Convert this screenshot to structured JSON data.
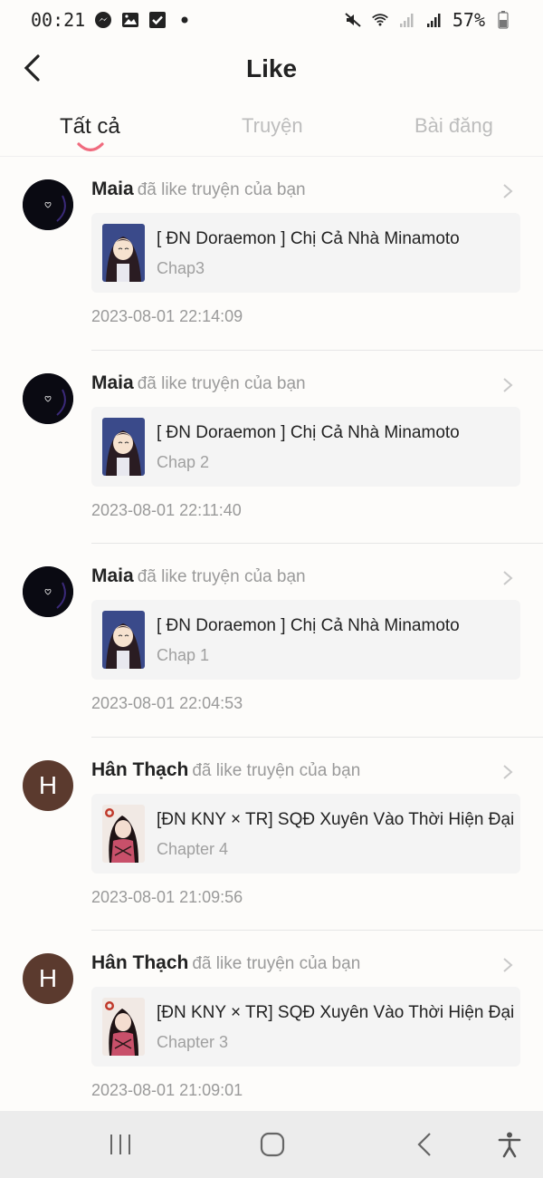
{
  "status_bar": {
    "time": "00:21",
    "battery": "57%",
    "left_icons": [
      "messenger-icon",
      "gallery-icon",
      "check-icon",
      "dot-icon"
    ],
    "right_icons": [
      "mute-icon",
      "wifi-icon",
      "signal-icon",
      "signal-icon",
      "battery-icon"
    ]
  },
  "header": {
    "title": "Like",
    "back_icon": "chevron-left-icon"
  },
  "tabs": [
    {
      "label": "Tất cả",
      "active": true
    },
    {
      "label": "Truyện",
      "active": false
    },
    {
      "label": "Bài đăng",
      "active": false
    }
  ],
  "notifications": [
    {
      "user": "Maia",
      "action": "đã like truyện của bạn",
      "story": "[ ĐN Doraemon ] Chị Cả Nhà Minamoto",
      "chapter": "Chap3",
      "time": "2023-08-01 22:14:09",
      "avatar_type": "dark"
    },
    {
      "user": "Maia",
      "action": "đã like truyện của bạn",
      "story": "[ ĐN Doraemon ] Chị Cả Nhà Minamoto",
      "chapter": "Chap 2",
      "time": "2023-08-01 22:11:40",
      "avatar_type": "dark"
    },
    {
      "user": "Maia",
      "action": "đã like truyện của bạn",
      "story": "[ ĐN Doraemon ] Chị Cả Nhà Minamoto",
      "chapter": "Chap 1",
      "time": "2023-08-01 22:04:53",
      "avatar_type": "dark"
    },
    {
      "user": "Hân Thạch",
      "action": "đã like truyện của bạn",
      "story": "[ĐN KNY × TR] SQĐ Xuyên Vào Thời Hiện Đại",
      "chapter": "Chapter 4",
      "time": "2023-08-01 21:09:56",
      "avatar_type": "letter",
      "avatar_letter": "H"
    },
    {
      "user": "Hân Thạch",
      "action": "đã like truyện của bạn",
      "story": "[ĐN KNY × TR] SQĐ Xuyên Vào Thời Hiện Đại",
      "chapter": "Chapter 3",
      "time": "2023-08-01 21:09:01",
      "avatar_type": "letter",
      "avatar_letter": "H"
    }
  ],
  "navbar": {
    "icons": [
      "recent-apps-icon",
      "home-icon",
      "back-icon",
      "accessibility-icon"
    ]
  },
  "colors": {
    "accent": "#f06b7e",
    "avatar_letter_bg": "#5b3a2e",
    "card_bg": "#f4f4f4"
  }
}
